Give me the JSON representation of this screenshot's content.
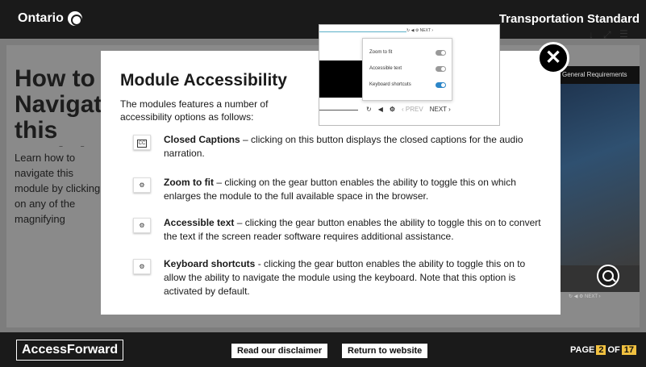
{
  "header": {
    "brand": "Ontario",
    "title": "Transportation Standard"
  },
  "background": {
    "heading": "How to Navigate this Module",
    "body": "Learn how to navigate this module by clicking on any of the magnifying glasses available on this page.",
    "video_caption": "General Requirements",
    "toolbar_icons": [
      "download-icon",
      "expand-icon",
      "menu-icon"
    ],
    "controls": "↻ ◀ ⚙ NEXT ›"
  },
  "modal": {
    "title": "Module Accessibility",
    "intro": "The modules features a number of accessibility options as follows:",
    "close_label": "✕",
    "preview": {
      "top_controls": "↻ ◀ ⚙  NEXT ›",
      "menu": [
        {
          "label": "Zoom to fit",
          "on": false
        },
        {
          "label": "Accessible text",
          "on": false
        },
        {
          "label": "Keyboard shortcuts",
          "on": true
        }
      ],
      "prev": "‹ PREV",
      "next": "NEXT ›"
    },
    "options": [
      {
        "icon": "cc-icon",
        "icon_text": "CC",
        "name": "Closed Captions",
        "desc": " – clicking on this button displays the closed captions for the audio narration."
      },
      {
        "icon": "gear-icon",
        "icon_text": "⚙",
        "name": "Zoom to fit",
        "desc": " – clicking on the gear button enables the ability to toggle this on which enlarges the module to the full available space in the browser."
      },
      {
        "icon": "gear-icon",
        "icon_text": "⚙",
        "name": "Accessible text",
        "desc": " – clicking the gear button enables the ability to toggle this on to convert the text if the screen reader software requires additional assistance."
      },
      {
        "icon": "gear-icon",
        "icon_text": "⚙",
        "name": "Keyboard shortcuts",
        "desc": " - clicking the gear button enables the ability to toggle this on to allow the ability to navigate the module using the keyboard.  Note that this option is activated by default."
      }
    ]
  },
  "footer": {
    "logo": "AccessForward",
    "disclaimer": "Read our disclaimer",
    "return": "Return to website",
    "page_prefix": "PAGE",
    "page_current": "2",
    "page_of": "OF",
    "page_total": "17"
  },
  "colors": {
    "toggle_on": "#2c86c8",
    "page_badge": "#f0c040"
  }
}
